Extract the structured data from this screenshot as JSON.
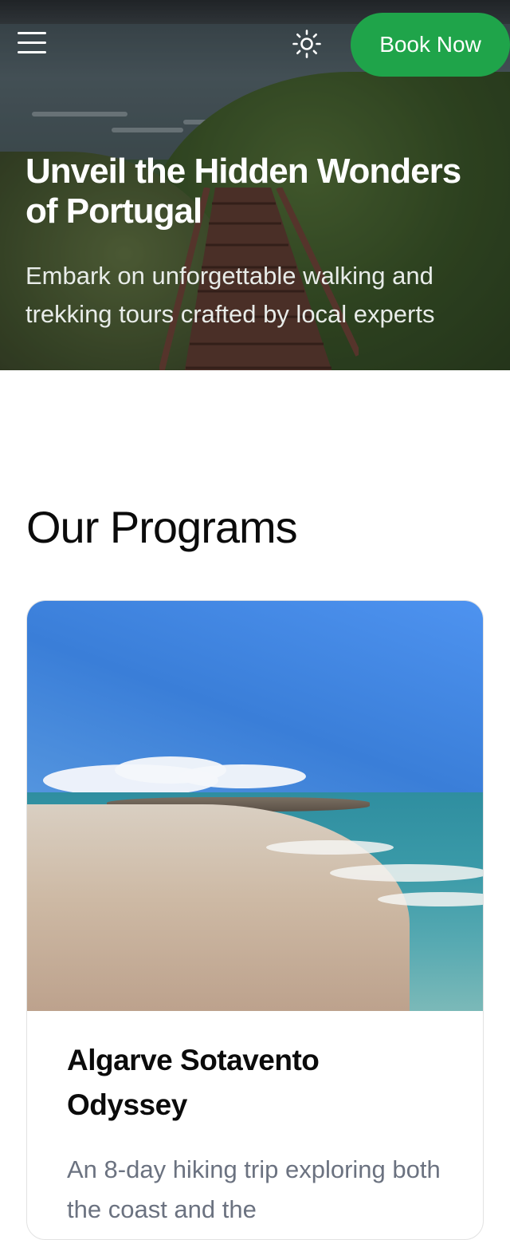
{
  "header": {
    "menu_icon": "hamburger-menu-icon",
    "theme_icon": "sun-icon",
    "book_label": "Book Now",
    "accent_color": "#1fa44a"
  },
  "hero": {
    "title": "Unveil the Hidden Wonders of Portugal",
    "subtitle": "Embark on unforgettable walking and trekking tours crafted by local experts"
  },
  "programs": {
    "heading": "Our Programs",
    "cards": [
      {
        "title": "Algarve Sotavento Odyssey",
        "description": "An 8-day hiking trip exploring both the coast and the"
      }
    ]
  }
}
